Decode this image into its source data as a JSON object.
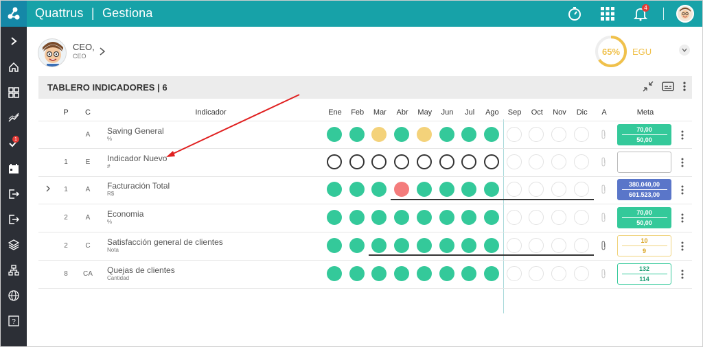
{
  "app": {
    "brand": "Quattrus",
    "section": "Gestiona",
    "notifications": "4"
  },
  "user": {
    "name": "CEO,",
    "role": "CEO"
  },
  "gauge": {
    "percent": "65%",
    "value": 0.65,
    "label": "EGU"
  },
  "panel": {
    "title": "TABLERO INDICADORES | 6"
  },
  "columns": {
    "p": "P",
    "c": "C",
    "indicador": "Indicador",
    "a": "A",
    "meta": "Meta",
    "months": [
      "Ene",
      "Feb",
      "Mar",
      "Abr",
      "May",
      "Jun",
      "Jul",
      "Ago",
      "Sep",
      "Oct",
      "Nov",
      "Dic"
    ]
  },
  "sidebar": {
    "badge": "1",
    "items": [
      "chevron-right-icon",
      "home-icon",
      "dashboard-icon",
      "trend-icon",
      "check-icon",
      "calendar-icon",
      "exit-icon",
      "logout-icon",
      "layers-icon",
      "sitemap-icon",
      "globe-icon",
      "help-icon"
    ]
  },
  "rows": [
    {
      "p": "",
      "c": "A",
      "name": "Saving General",
      "unit": "%",
      "months": [
        "green",
        "green",
        "yellow",
        "green",
        "yellow",
        "green",
        "green",
        "green",
        "empty",
        "empty",
        "empty",
        "empty"
      ],
      "meta_top": "70,00",
      "meta_bottom": "50,00",
      "meta_style": "green"
    },
    {
      "p": "1",
      "c": "E",
      "name": "Indicador Nuevo",
      "unit": "#",
      "months": [
        "hollow",
        "hollow",
        "hollow",
        "hollow",
        "hollow",
        "hollow",
        "hollow",
        "hollow",
        "empty",
        "empty",
        "empty",
        "empty"
      ],
      "meta_top": "",
      "meta_bottom": "",
      "meta_style": "empty"
    },
    {
      "p": "1",
      "c": "A",
      "name": "Facturación Total",
      "unit": "R$",
      "months": [
        "green",
        "green",
        "green",
        "red",
        "green",
        "green",
        "green",
        "green",
        "empty",
        "empty",
        "empty",
        "empty"
      ],
      "meta_top": "380.040,00",
      "meta_bottom": "601.523,00",
      "meta_style": "blue"
    },
    {
      "p": "2",
      "c": "A",
      "name": "Economia",
      "unit": "%",
      "months": [
        "green",
        "green",
        "green",
        "green",
        "green",
        "green",
        "green",
        "green",
        "empty",
        "empty",
        "empty",
        "empty"
      ],
      "meta_top": "70,00",
      "meta_bottom": "50,00",
      "meta_style": "green"
    },
    {
      "p": "2",
      "c": "C",
      "name": "Satisfacción general de clientes",
      "unit": "Nota",
      "months": [
        "green",
        "green",
        "green",
        "green",
        "green",
        "green",
        "green",
        "green",
        "empty",
        "empty",
        "empty",
        "empty"
      ],
      "meta_top": "10",
      "meta_bottom": "9",
      "meta_style": "yellowb"
    },
    {
      "p": "8",
      "c": "CA",
      "name": "Quejas de clientes",
      "unit": "Cantidad",
      "months": [
        "green",
        "green",
        "green",
        "green",
        "green",
        "green",
        "green",
        "green",
        "empty",
        "empty",
        "empty",
        "empty"
      ],
      "meta_top": "132",
      "meta_bottom": "114",
      "meta_style": "greenb"
    }
  ]
}
